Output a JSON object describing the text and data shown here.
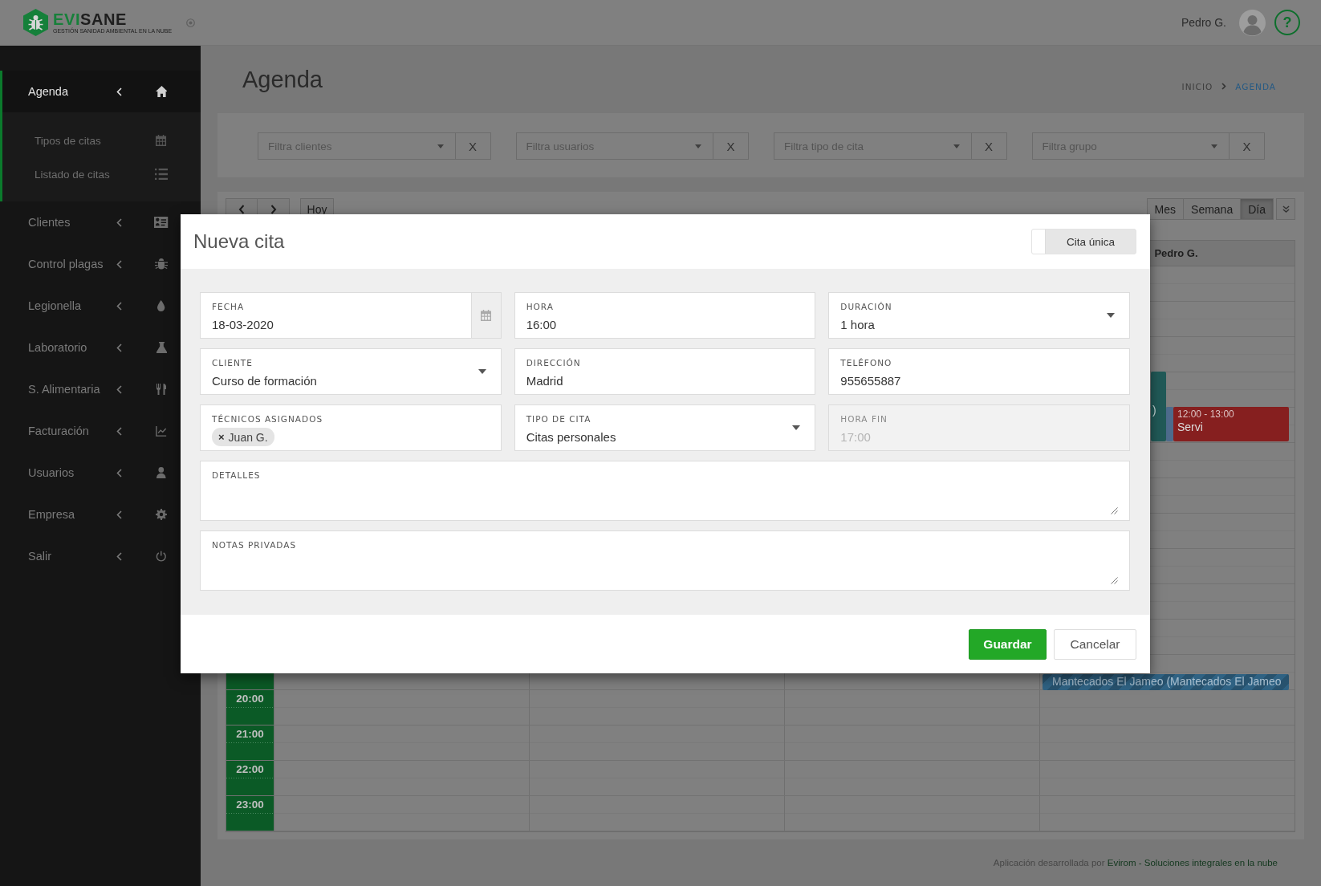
{
  "topbar": {
    "logo": {
      "name_parts": [
        "EVI",
        "SANE"
      ],
      "tagline": "GESTIÓN SANIDAD AMBIENTAL EN LA NUBE"
    },
    "user_name": "Pedro G.",
    "help_label": "?"
  },
  "sidebar": {
    "items": [
      {
        "label": "Agenda",
        "selected": true,
        "children": [
          {
            "label": "Tipos de citas",
            "selected": false
          },
          {
            "label": "Listado de citas",
            "selected": false
          }
        ]
      },
      {
        "label": "Clientes",
        "selected": false
      },
      {
        "label": "Control plagas",
        "selected": false
      },
      {
        "label": "Legionella",
        "selected": false
      },
      {
        "label": "Laboratorio",
        "selected": false
      },
      {
        "label": "S. Alimentaria",
        "selected": false
      },
      {
        "label": "Facturación",
        "selected": false
      },
      {
        "label": "Usuarios",
        "selected": false
      },
      {
        "label": "Empresa",
        "selected": false
      },
      {
        "label": "Salir",
        "selected": false
      }
    ]
  },
  "page": {
    "title": "Agenda",
    "breadcrumb": [
      {
        "label": "INICIO",
        "current": false
      },
      {
        "label": "AGENDA",
        "current": true
      }
    ]
  },
  "filters": [
    {
      "placeholder": "Filtra clientes",
      "clear": "X"
    },
    {
      "placeholder": "Filtra usuarios",
      "clear": "X"
    },
    {
      "placeholder": "Filtra tipo de cita",
      "clear": "X"
    },
    {
      "placeholder": "Filtra grupo",
      "clear": "X"
    }
  ],
  "calendar": {
    "today_label": "Hoy",
    "views": [
      {
        "label": "Mes",
        "selected": false
      },
      {
        "label": "Semana",
        "selected": false
      },
      {
        "label": "Día",
        "selected": true
      }
    ],
    "column_headings": [
      "Pedro G."
    ],
    "time_labels": [
      "20:00",
      "21:00",
      "22:00",
      "23:00"
    ],
    "events": [
      {
        "title": ")",
        "color": "#215a58",
        "striped": false
      },
      {
        "color": "#4d6b8c",
        "striped": false
      },
      {
        "time": "12:00 - 13:00",
        "title": "Servi",
        "color": "#861f1f",
        "striped": false
      },
      {
        "title": "Mantecados El Jameo (Mantecados El Jameo",
        "color": "#2f6283",
        "striped": true
      }
    ]
  },
  "modal": {
    "title": "Nueva cita",
    "toggle": {
      "label": "Cita única",
      "on": false
    },
    "fields": [
      {
        "kind": "date",
        "label": "FECHA",
        "value": "18-03-2020",
        "disabled": false
      },
      {
        "kind": "text",
        "label": "HORA",
        "value": "16:00",
        "disabled": false
      },
      {
        "kind": "select",
        "label": "DURACIÓN",
        "value": "1 hora",
        "disabled": false
      },
      {
        "kind": "select",
        "label": "CLIENTE",
        "value": "Curso de formación",
        "disabled": false
      },
      {
        "kind": "text",
        "label": "DIRECCIÓN",
        "value": "Madrid",
        "disabled": false
      },
      {
        "kind": "text",
        "label": "TELÉFONO",
        "value": "955655887",
        "disabled": false
      },
      {
        "kind": "tags",
        "label": "TÉCNICOS ASIGNADOS",
        "tags": [
          {
            "label": "Juan G.",
            "remove": "×"
          }
        ],
        "disabled": false
      },
      {
        "kind": "select",
        "label": "TIPO DE CITA",
        "value": "Citas personales",
        "disabled": false
      },
      {
        "kind": "text",
        "label": "HORA FIN",
        "value": "17:00",
        "disabled": true
      },
      {
        "kind": "textarea",
        "label": "DETALLES",
        "disabled": false
      },
      {
        "kind": "textarea",
        "label": "NOTAS PRIVADAS",
        "disabled": false
      }
    ],
    "buttons": [
      {
        "label": "Guardar",
        "kind": "primary"
      },
      {
        "label": "Cancelar",
        "kind": "secondary"
      }
    ]
  },
  "footer": {
    "text": "Aplicación desarrollada por",
    "link": "Evirom - Soluciones integrales en la nube"
  }
}
